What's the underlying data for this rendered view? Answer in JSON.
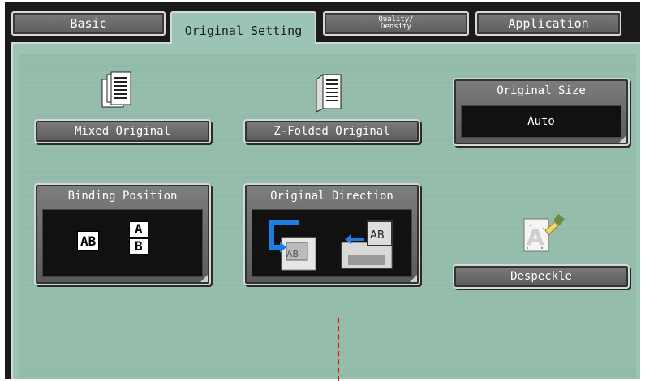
{
  "tabs": {
    "basic": "Basic",
    "original_setting": "Original Setting",
    "quality_line1": "Quality/",
    "quality_line2": "Density",
    "application": "Application"
  },
  "buttons": {
    "mixed_original": "Mixed Original",
    "z_folded_original": "Z-Folded Original",
    "despeckle": "Despeckle"
  },
  "original_size": {
    "title": "Original Size",
    "value": "Auto"
  },
  "binding_position": {
    "title": "Binding Position",
    "option_left_right": "AB",
    "option_top_a": "A",
    "option_top_b": "B"
  },
  "original_direction": {
    "title": "Original Direction",
    "icon_label_1": "AB",
    "icon_label_2": "AB"
  },
  "colors": {
    "panel": "#9cc4b4",
    "button": "#6b6b6b",
    "guide_line": "#ff0000"
  }
}
